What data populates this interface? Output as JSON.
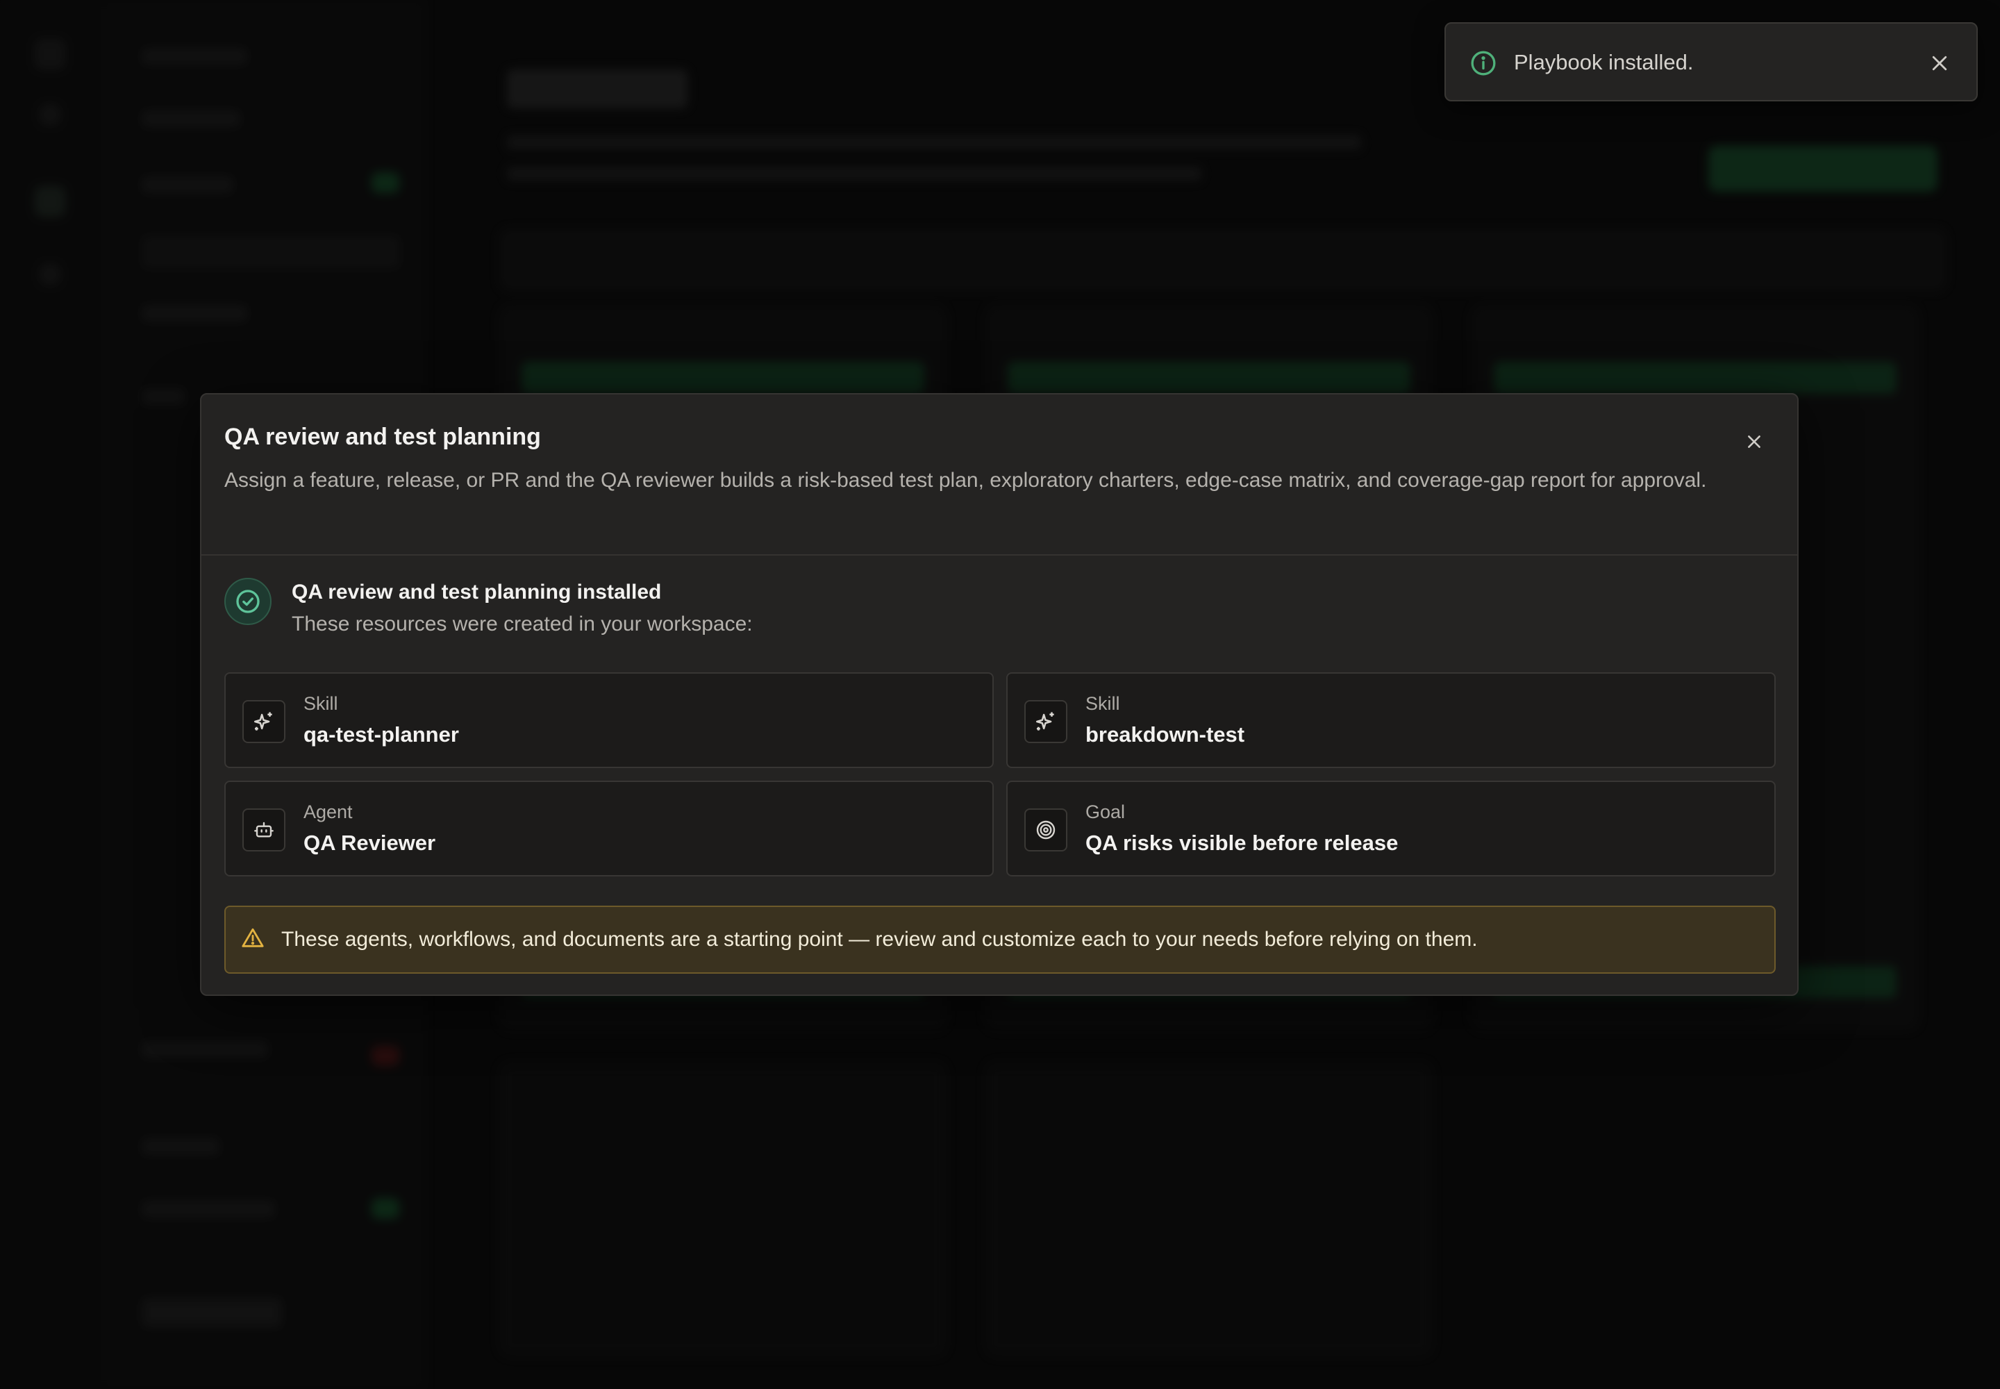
{
  "toast": {
    "message": "Playbook installed.",
    "icon": "info-icon",
    "accent": "#4fb07a"
  },
  "dialog": {
    "title": "QA review and test planning",
    "description": "Assign a feature, release, or PR and the QA reviewer builds a risk-based test plan, exploratory charters, edge-case matrix, and coverage-gap report for approval.",
    "success": {
      "title": "QA review and test planning installed",
      "subtitle": "These resources were created in your workspace:"
    },
    "resources": [
      {
        "type": "Skill",
        "name": "qa-test-planner",
        "icon": "sparkle-icon"
      },
      {
        "type": "Skill",
        "name": "breakdown-test",
        "icon": "sparkle-icon"
      },
      {
        "type": "Agent",
        "name": "QA Reviewer",
        "icon": "bot-icon"
      },
      {
        "type": "Goal",
        "name": "QA risks visible before release",
        "icon": "target-icon"
      }
    ],
    "warning": "These agents, workflows, and documents are a starting point — review and customize each to your needs before relying on them."
  },
  "colors": {
    "success": "#5ec49a",
    "warning": "#e3b341",
    "background": "#0c0c0c",
    "dialog": "#242322"
  }
}
